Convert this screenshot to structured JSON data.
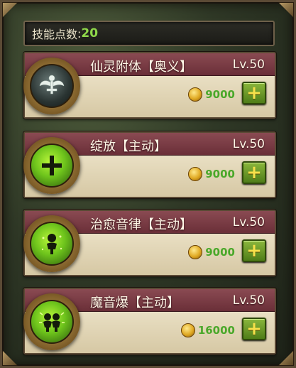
{
  "skill_points": {
    "label": "技能点数",
    "colon": ":",
    "value": "20"
  },
  "skills": [
    {
      "name": "仙灵附体【奥义】",
      "level": "Lv.50",
      "cost": "9000",
      "icon": "spirit-wings-icon"
    },
    {
      "name": "绽放【主动】",
      "level": "Lv.50",
      "cost": "9000",
      "icon": "bloom-cross-icon"
    },
    {
      "name": "治愈音律【主动】",
      "level": "Lv.50",
      "cost": "9000",
      "icon": "healing-figure-icon"
    },
    {
      "name": "魔音爆【主动】",
      "level": "Lv.50",
      "cost": "16000",
      "icon": "sound-burst-icon"
    }
  ],
  "add_button_label": "+",
  "colors": {
    "accent_green": "#8fd84a",
    "header": "#7a3c45",
    "cost": "#4aa82a"
  }
}
